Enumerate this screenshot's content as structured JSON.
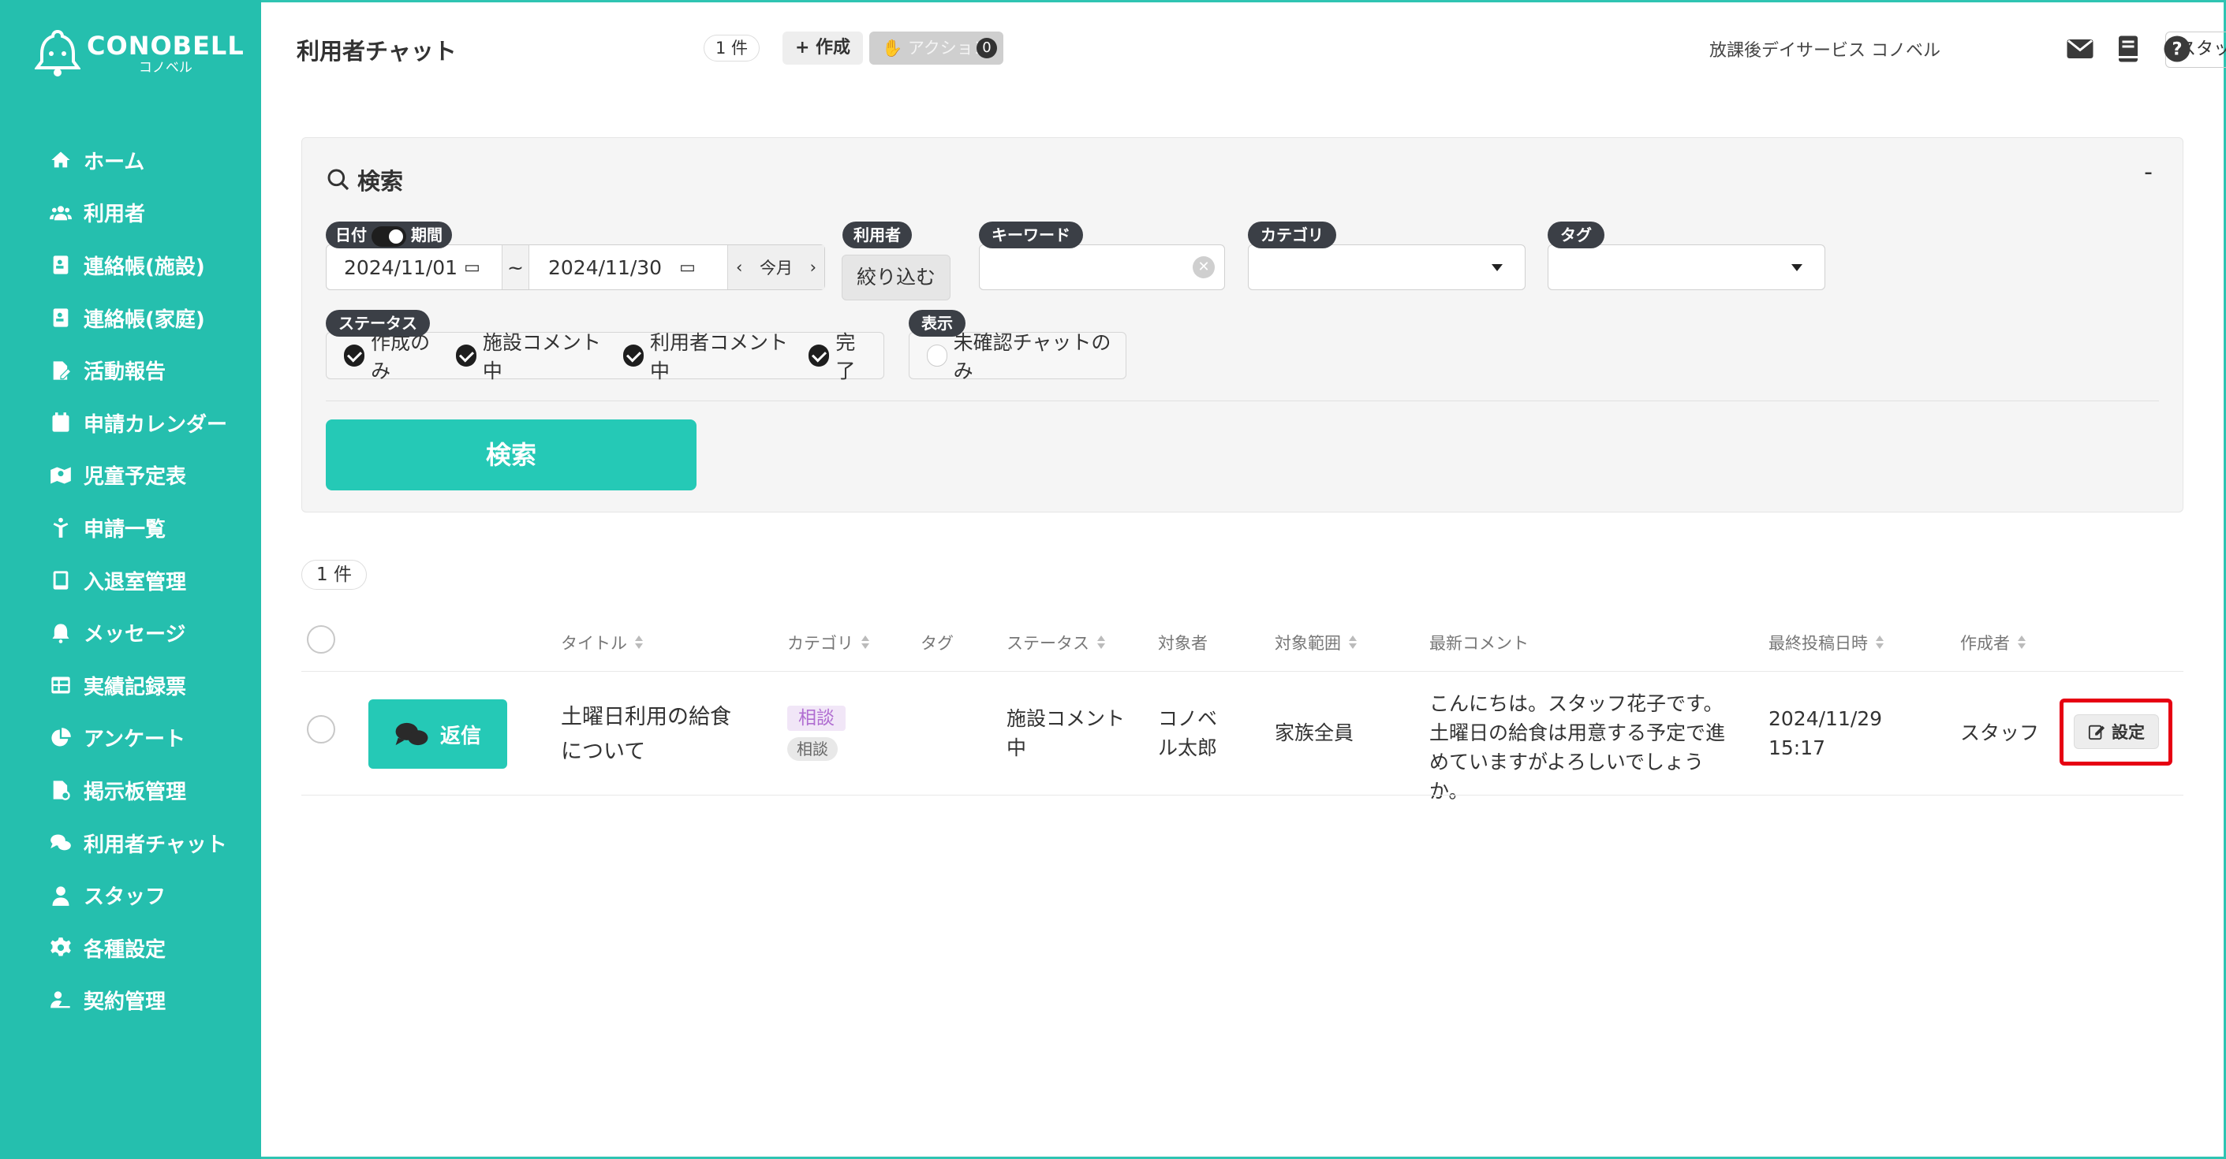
{
  "brand": {
    "name": "CONOBELL",
    "sub": "コノベル"
  },
  "sidebar": {
    "items": [
      {
        "label": "ホーム",
        "icon": "home-icon"
      },
      {
        "label": "利用者",
        "icon": "users-icon"
      },
      {
        "label": "連絡帳(施設)",
        "icon": "contact-book-icon"
      },
      {
        "label": "連絡帳(家庭)",
        "icon": "contact-book-icon"
      },
      {
        "label": "活動報告",
        "icon": "report-icon"
      },
      {
        "label": "申請カレンダー",
        "icon": "calendar-icon"
      },
      {
        "label": "児童予定表",
        "icon": "map-icon"
      },
      {
        "label": "申請一覧",
        "icon": "child-icon"
      },
      {
        "label": "入退室管理",
        "icon": "tablet-icon"
      },
      {
        "label": "メッセージ",
        "icon": "bell-icon"
      },
      {
        "label": "実績記録票",
        "icon": "table-icon"
      },
      {
        "label": "アンケート",
        "icon": "pie-chart-icon"
      },
      {
        "label": "掲示板管理",
        "icon": "board-icon"
      },
      {
        "label": "利用者チャット",
        "icon": "chat-icon"
      },
      {
        "label": "スタッフ",
        "icon": "staff-icon"
      },
      {
        "label": "各種設定",
        "icon": "gear-icon"
      },
      {
        "label": "契約管理",
        "icon": "contract-icon"
      }
    ]
  },
  "header": {
    "title": "利用者チャット",
    "count": "1 件",
    "create_label": "+ 作成",
    "action_label": "アクション",
    "action_badge": "0",
    "facility": "放課後デイサービス コノベル",
    "staff": "スタッフ 花子"
  },
  "search": {
    "title": "検索",
    "collapse": "-",
    "date_label_a": "日付",
    "date_label_b": "期間",
    "date_from": "2024/11/01",
    "date_sep": "~",
    "date_to": "2024/11/30",
    "this_month": "今月",
    "user_label": "利用者",
    "narrow_label": "絞り込む",
    "keyword_label": "キーワード",
    "category_label": "カテゴリ",
    "tag_label": "タグ",
    "status_label": "ステータス",
    "statuses": [
      "作成のみ",
      "施設コメント中",
      "利用者コメント中",
      "完了"
    ],
    "display_label": "表示",
    "display_option": "未確認チャットのみ",
    "submit": "検索"
  },
  "results": {
    "count": "1 件",
    "columns": [
      "タイトル",
      "カテゴリ",
      "タグ",
      "ステータス",
      "対象者",
      "対象範囲",
      "最新コメント",
      "最終投稿日時",
      "作成者"
    ],
    "rows": [
      {
        "reply": "返信",
        "title": "土曜日利用の給食について",
        "category": "相談",
        "category_sub": "相談",
        "tag": "",
        "status": "施設コメント中",
        "target": "コノベル太郎",
        "scope": "家族全員",
        "comment": "こんにちは。スタッフ花子です。土曜日の給食は用意する予定で進めていますがよろしいでしょうか。",
        "date": "2024/11/29",
        "time": "15:17",
        "author": "スタッフ",
        "settings": "設定"
      }
    ]
  },
  "colors": {
    "accent": "#25bfae",
    "button": "#25c9b6",
    "highlight": "#e60012"
  }
}
